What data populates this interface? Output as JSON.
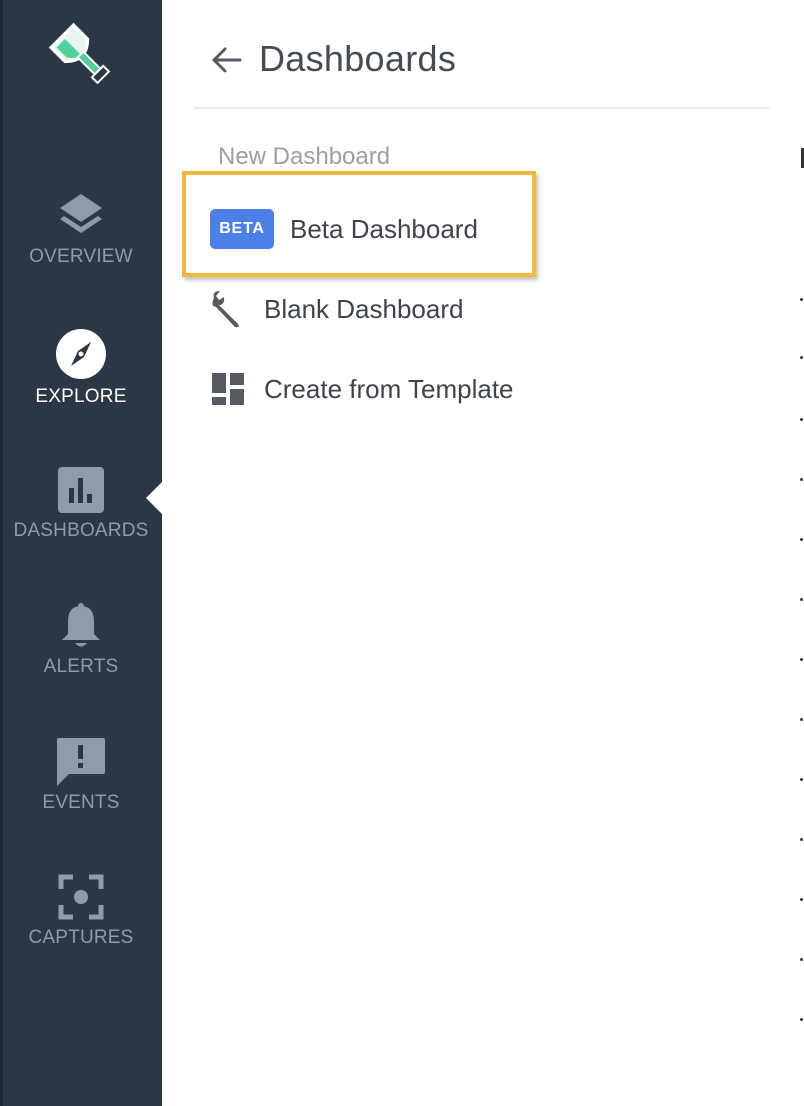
{
  "sidebar": {
    "items": [
      {
        "label": "OVERVIEW",
        "icon": "layers-icon",
        "active": false
      },
      {
        "label": "EXPLORE",
        "icon": "compass-icon",
        "active": true
      },
      {
        "label": "DASHBOARDS",
        "icon": "bar-chart-icon",
        "active": false
      },
      {
        "label": "ALERTS",
        "icon": "bell-icon",
        "active": false
      },
      {
        "label": "EVENTS",
        "icon": "alert-message-icon",
        "active": false
      },
      {
        "label": "CAPTURES",
        "icon": "capture-focus-icon",
        "active": false
      }
    ]
  },
  "panel": {
    "title": "Dashboards",
    "section_label": "New Dashboard",
    "menu": [
      {
        "label": "Beta Dashboard",
        "badge": "BETA"
      },
      {
        "label": "Blank Dashboard",
        "icon": "wrench-icon"
      },
      {
        "label": "Create from Template",
        "icon": "template-grid-icon"
      }
    ]
  },
  "colors": {
    "sidebar_bg": "#2a3744",
    "accent_green": "#4fd19a",
    "beta_badge": "#4a80e8",
    "highlight": "#f3b73b"
  }
}
